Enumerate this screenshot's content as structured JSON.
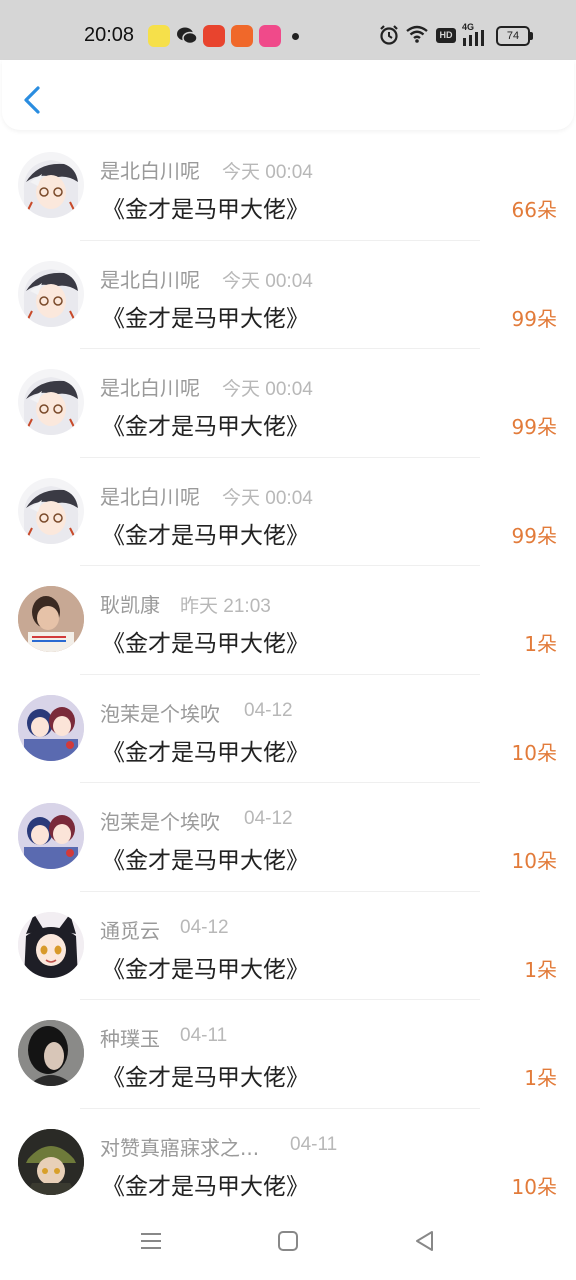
{
  "status_bar": {
    "time": "20:08",
    "network": "4G",
    "hd": "HD",
    "battery": "74"
  },
  "header": {
    "back_icon": "chevron-left-icon",
    "accent_color": "#2a8de0"
  },
  "items": [
    {
      "name": "是北白川呢",
      "time": "今天 00:04",
      "work": "《金才是马甲大佬》",
      "amount": "66朵",
      "avatar": "anime-white-hair"
    },
    {
      "name": "是北白川呢",
      "time": "今天 00:04",
      "work": "《金才是马甲大佬》",
      "amount": "99朵",
      "avatar": "anime-white-hair"
    },
    {
      "name": "是北白川呢",
      "time": "今天 00:04",
      "work": "《金才是马甲大佬》",
      "amount": "99朵",
      "avatar": "anime-white-hair"
    },
    {
      "name": "是北白川呢",
      "time": "今天 00:04",
      "work": "《金才是马甲大佬》",
      "amount": "99朵",
      "avatar": "anime-white-hair"
    },
    {
      "name": "耿凯康",
      "time": "昨天 21:03",
      "work": "《金才是马甲大佬》",
      "amount": "1朵",
      "avatar": "photo-person"
    },
    {
      "name": "泡茉是个埃吹",
      "time": "04-12",
      "work": "《金才是马甲大佬》",
      "amount": "10朵",
      "avatar": "anime-duo"
    },
    {
      "name": "泡茉是个埃吹",
      "time": "04-12",
      "work": "《金才是马甲大佬》",
      "amount": "10朵",
      "avatar": "anime-duo"
    },
    {
      "name": "通觅云",
      "time": "04-12",
      "work": "《金才是马甲大佬》",
      "amount": "1朵",
      "avatar": "anime-catgirl"
    },
    {
      "name": "种璞玉",
      "time": "04-11",
      "work": "《金才是马甲大佬》",
      "amount": "1朵",
      "avatar": "photo-dark-hair"
    },
    {
      "name": "对赞真寤寐求之...",
      "time": "04-11",
      "work": "《金才是马甲大佬》",
      "amount": "10朵",
      "avatar": "anime-green-cap"
    }
  ],
  "nav": {
    "menu_icon": "menu-icon",
    "home_icon": "square-home-icon",
    "back_icon": "triangle-back-icon"
  },
  "colors": {
    "amount": "#e27b3a",
    "name": "#9a9a9a",
    "time": "#b8b8b8",
    "title": "#222222"
  }
}
